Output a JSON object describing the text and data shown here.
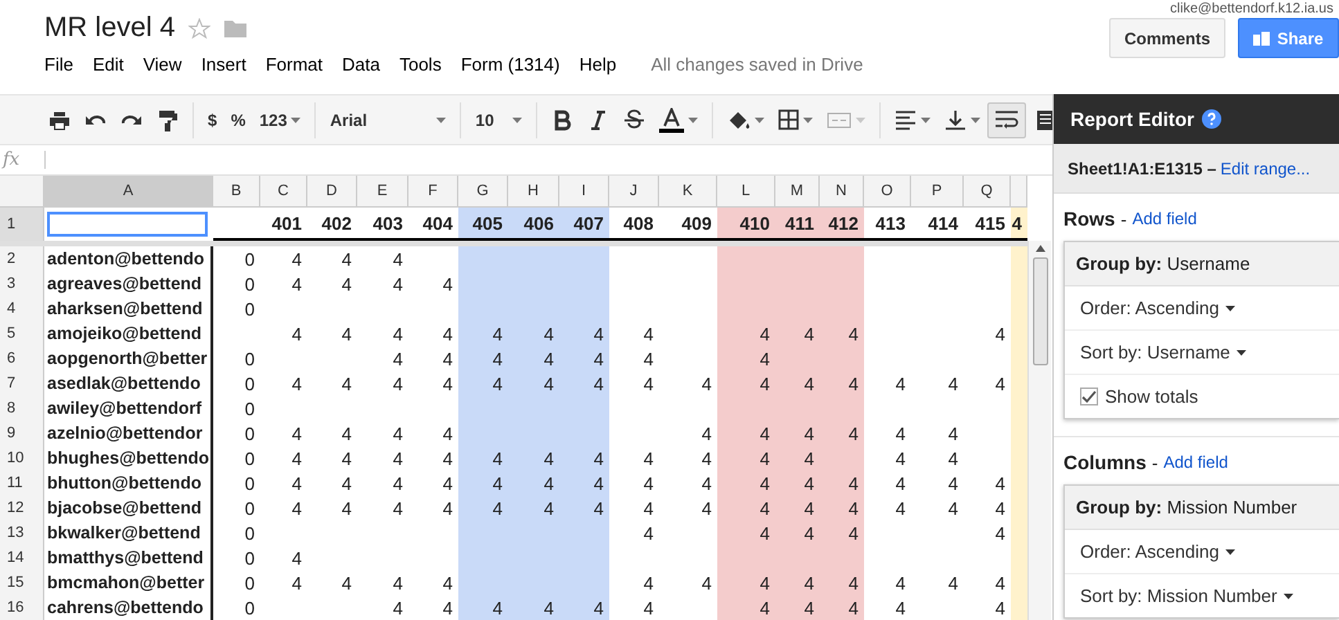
{
  "document": {
    "title": "MR level 4",
    "account": "clike@bettendorf.k12.ia.us",
    "starred": false
  },
  "menu": [
    "File",
    "Edit",
    "View",
    "Insert",
    "Format",
    "Data",
    "Tools",
    "Form (1314)",
    "Help"
  ],
  "save_status": "All changes saved in Drive",
  "buttons": {
    "comments": "Comments",
    "share": "Share"
  },
  "toolbar": {
    "number_formats": [
      "$",
      "%",
      "123"
    ],
    "font": "Arial",
    "font_size": "10",
    "merge_disabled": true,
    "wrap_on": true
  },
  "formula_bar": {
    "label": "fx"
  },
  "columns": [
    {
      "letter": "A",
      "selected": true
    },
    {
      "letter": "B",
      "selected": false
    },
    {
      "letter": "C",
      "selected": false
    },
    {
      "letter": "D",
      "selected": false
    },
    {
      "letter": "E",
      "selected": false
    },
    {
      "letter": "F",
      "selected": false
    },
    {
      "letter": "G",
      "selected": false,
      "color": "#c9daf8"
    },
    {
      "letter": "H",
      "selected": false,
      "color": "#c9daf8"
    },
    {
      "letter": "I",
      "selected": false,
      "color": "#c9daf8"
    },
    {
      "letter": "J",
      "selected": false
    },
    {
      "letter": "K",
      "selected": false
    },
    {
      "letter": "L",
      "selected": false,
      "color": "#f4cccc"
    },
    {
      "letter": "M",
      "selected": false,
      "color": "#f4cccc"
    },
    {
      "letter": "N",
      "selected": false,
      "color": "#f4cccc"
    },
    {
      "letter": "O",
      "selected": false
    },
    {
      "letter": "P",
      "selected": false
    },
    {
      "letter": "Q",
      "selected": false
    },
    {
      "selected": false,
      "color": "#fff2cc"
    }
  ],
  "rows": [
    {
      "number": "1",
      "selected": true,
      "values": {
        "C": "401",
        "D": "402",
        "E": "403",
        "F": "404",
        "G": "405",
        "H": "406",
        "I": "407",
        "J": "408",
        "K": "409",
        "L": "410",
        "M": "411",
        "N": "412",
        "O": "413",
        "P": "414",
        "Q": "415",
        "R": "4"
      }
    },
    {
      "number": "2",
      "selected": false,
      "user": "adenton@bettendo",
      "values": {
        "B": "0",
        "C": "4",
        "D": "4",
        "E": "4"
      }
    },
    {
      "number": "3",
      "selected": false,
      "user": "agreaves@bettend",
      "values": {
        "B": "0",
        "C": "4",
        "D": "4",
        "E": "4",
        "F": "4"
      }
    },
    {
      "number": "4",
      "selected": false,
      "user": "aharksen@bettend",
      "values": {
        "B": "0"
      }
    },
    {
      "number": "5",
      "selected": false,
      "user": "amojeiko@bettend",
      "values": {
        "C": "4",
        "D": "4",
        "E": "4",
        "F": "4",
        "G": "4",
        "H": "4",
        "I": "4",
        "J": "4",
        "L": "4",
        "M": "4",
        "N": "4",
        "Q": "4"
      }
    },
    {
      "number": "6",
      "selected": false,
      "user": "aopgenorth@better",
      "values": {
        "B": "0",
        "E": "4",
        "F": "4",
        "G": "4",
        "H": "4",
        "I": "4",
        "J": "4",
        "L": "4"
      }
    },
    {
      "number": "7",
      "selected": false,
      "user": "asedlak@bettendo",
      "values": {
        "B": "0",
        "C": "4",
        "D": "4",
        "E": "4",
        "F": "4",
        "G": "4",
        "H": "4",
        "I": "4",
        "J": "4",
        "K": "4",
        "L": "4",
        "M": "4",
        "N": "4",
        "O": "4",
        "P": "4",
        "Q": "4"
      }
    },
    {
      "number": "8",
      "selected": false,
      "user": "awiley@bettendorf",
      "values": {
        "B": "0"
      }
    },
    {
      "number": "9",
      "selected": false,
      "user": "azelnio@bettendor",
      "values": {
        "B": "0",
        "C": "4",
        "D": "4",
        "E": "4",
        "F": "4",
        "K": "4",
        "L": "4",
        "M": "4",
        "N": "4",
        "O": "4",
        "P": "4"
      }
    },
    {
      "number": "10",
      "selected": false,
      "user": "bhughes@bettendo",
      "values": {
        "B": "0",
        "C": "4",
        "D": "4",
        "E": "4",
        "F": "4",
        "G": "4",
        "H": "4",
        "I": "4",
        "J": "4",
        "K": "4",
        "L": "4",
        "M": "4",
        "O": "4",
        "P": "4"
      }
    },
    {
      "number": "11",
      "selected": false,
      "user": "bhutton@bettendo",
      "values": {
        "B": "0",
        "C": "4",
        "D": "4",
        "E": "4",
        "F": "4",
        "G": "4",
        "H": "4",
        "I": "4",
        "J": "4",
        "K": "4",
        "L": "4",
        "M": "4",
        "N": "4",
        "O": "4",
        "P": "4",
        "Q": "4"
      }
    },
    {
      "number": "12",
      "selected": false,
      "user": "bjacobse@bettend",
      "values": {
        "B": "0",
        "C": "4",
        "D": "4",
        "E": "4",
        "F": "4",
        "G": "4",
        "H": "4",
        "I": "4",
        "J": "4",
        "K": "4",
        "L": "4",
        "M": "4",
        "N": "4",
        "O": "4",
        "P": "4",
        "Q": "4"
      }
    },
    {
      "number": "13",
      "selected": false,
      "user": "bkwalker@bettend",
      "values": {
        "B": "0",
        "J": "4",
        "L": "4",
        "M": "4",
        "N": "4",
        "Q": "4"
      }
    },
    {
      "number": "14",
      "selected": false,
      "user": "bmatthys@bettend",
      "values": {
        "B": "0",
        "C": "4"
      }
    },
    {
      "number": "15",
      "selected": false,
      "user": "bmcmahon@better",
      "values": {
        "B": "0",
        "C": "4",
        "D": "4",
        "E": "4",
        "F": "4",
        "J": "4",
        "K": "4",
        "L": "4",
        "M": "4",
        "N": "4",
        "O": "4",
        "P": "4",
        "Q": "4"
      }
    },
    {
      "number": "16",
      "selected": false,
      "user": "cahrens@bettendo",
      "values": {
        "B": "0",
        "E": "4",
        "F": "4",
        "G": "4",
        "H": "4",
        "I": "4",
        "J": "4",
        "L": "4",
        "M": "4",
        "N": "4",
        "O": "4",
        "Q": "4"
      }
    }
  ],
  "report_editor": {
    "title": "Report Editor",
    "range": "Sheet1!A1:E1315 –",
    "edit_link": "Edit range...",
    "sections": [
      {
        "heading": "Rows",
        "separator": "-",
        "add_link": "Add field",
        "group": {
          "title": "**Group by:** Username",
          "options": [
            {
              "kind": "dropdown",
              "label": "Order: Ascending"
            },
            {
              "kind": "dropdown",
              "label": "Sort by: Username"
            },
            {
              "kind": "checkbox",
              "label": "Show totals",
              "checked": true
            }
          ]
        }
      },
      {
        "heading": "Columns",
        "separator": "-",
        "add_link": "Add field",
        "group": {
          "title": "**Group by:** Mission Number",
          "options": [
            {
              "kind": "dropdown",
              "label": "Order: Ascending"
            },
            {
              "kind": "dropdown",
              "label": "Sort by: Mission Number"
            }
          ]
        }
      }
    ]
  }
}
